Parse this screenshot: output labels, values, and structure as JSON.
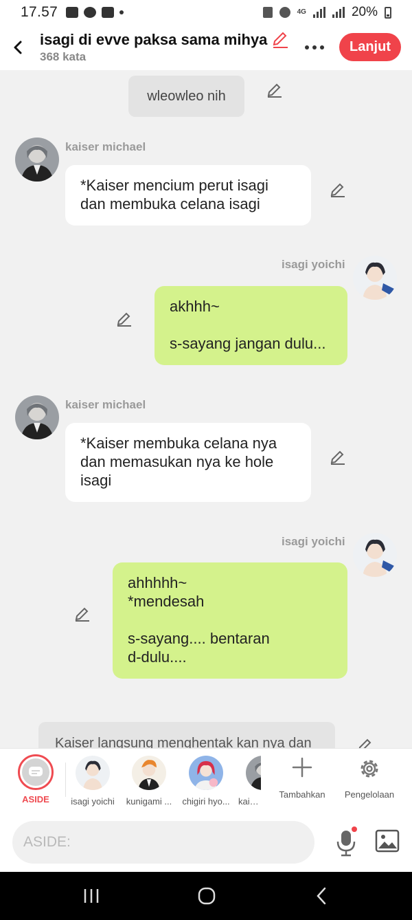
{
  "status_bar": {
    "time": "17.57",
    "network": "4G",
    "battery": "20%"
  },
  "header": {
    "title": "isagi di evve paksa sama mihya",
    "subtitle": "368 kata",
    "next_label": "Lanjut"
  },
  "chat": {
    "system_note": "wleowleo nih",
    "messages": [
      {
        "sender": "kaiser michael",
        "side": "left",
        "text": "*Kaiser mencium perut isagi\ndan membuka celana isagi"
      },
      {
        "sender": "isagi yoichi",
        "side": "right",
        "text": "akhhh~\n\ns-sayang jangan dulu..."
      },
      {
        "sender": "kaiser michael",
        "side": "left",
        "text": "*Kaiser membuka celana nya\ndan memasukan nya ke hole\nisagi"
      },
      {
        "sender": "isagi yoichi",
        "side": "right",
        "text": "ahhhhh~\n*mendesah\n\ns-sayang.... bentaran\nd-dulu...."
      }
    ],
    "partial_message": "Kaiser langsung menghentak kan nya dan"
  },
  "character_bar": {
    "aside_label": "ASIDE",
    "characters": [
      "isagi yoichi",
      "kunigami ...",
      "chigiri hyo...",
      "kaiser"
    ],
    "add_label": "Tambahkan",
    "manage_label": "Pengelolaan"
  },
  "composer": {
    "placeholder": "ASIDE:"
  },
  "colors": {
    "accent": "#f0434a",
    "right_bubble": "#d4f28c",
    "left_bubble": "#ffffff",
    "background": "#f1f1f1"
  }
}
